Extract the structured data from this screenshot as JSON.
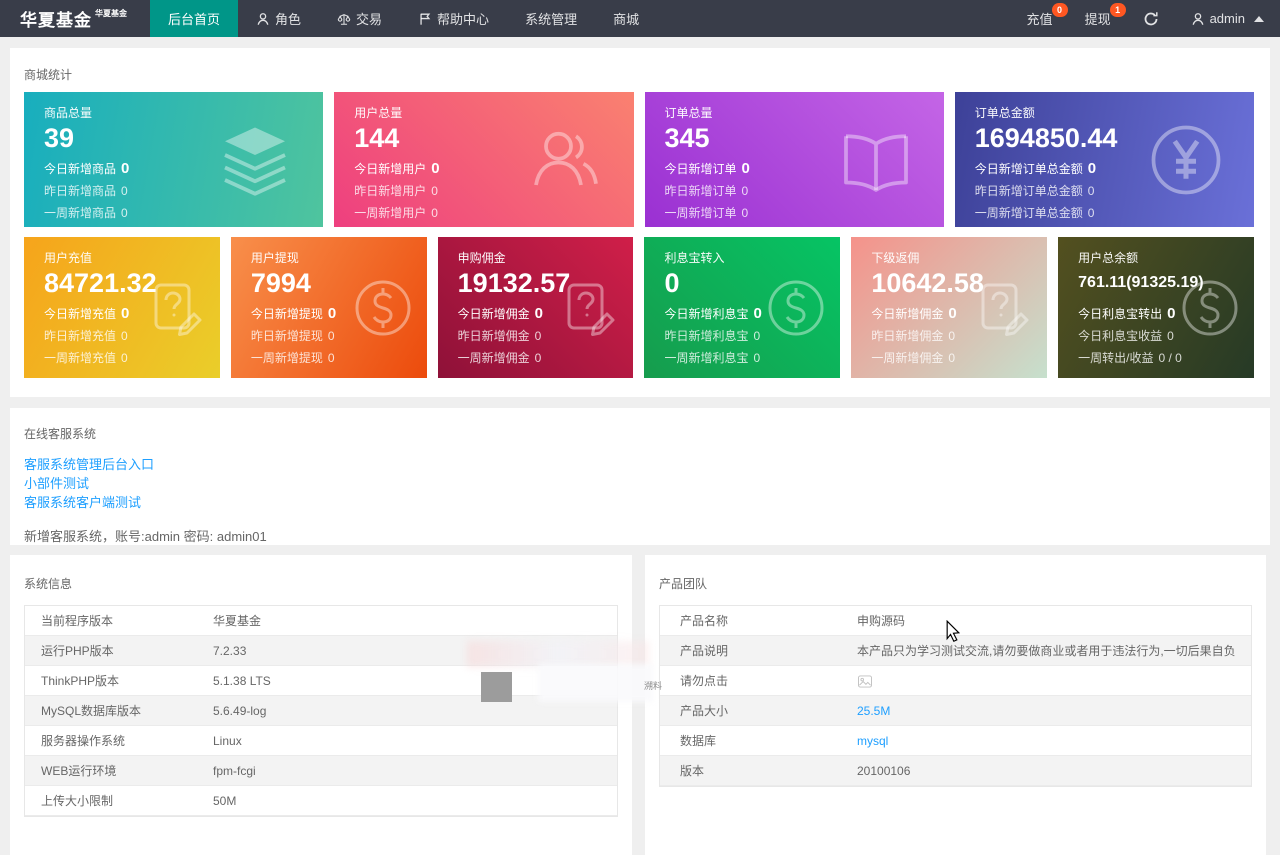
{
  "navbar": {
    "logo": "华夏基金",
    "logo_sup": "华夏基金",
    "items": [
      {
        "label": "后台首页",
        "icon": null,
        "active": true
      },
      {
        "label": "角色",
        "icon": "person",
        "active": false
      },
      {
        "label": "交易",
        "icon": "scales",
        "active": false
      },
      {
        "label": "帮助中心",
        "icon": "flag",
        "active": false
      },
      {
        "label": "系统管理",
        "icon": null,
        "active": false
      },
      {
        "label": "商城",
        "icon": null,
        "active": false
      }
    ],
    "right": [
      {
        "name": "recharge",
        "label": "充值",
        "badge": "0"
      },
      {
        "name": "withdraw",
        "label": "提现",
        "badge": "1"
      },
      {
        "name": "refresh",
        "label": "",
        "icon": "refresh"
      },
      {
        "name": "admin-menu",
        "label": "admin",
        "icon": "person",
        "caret": true
      }
    ],
    "colors": {
      "bg": "#393d49",
      "active": "#009688",
      "badge": "#ff5722"
    }
  },
  "stats": {
    "title": "商城统计",
    "row1": [
      {
        "title": "商品总量",
        "value": "39",
        "icon": "layers",
        "gradient": {
          "from": "#18aebe",
          "to": "#4fc49e",
          "dir": "100deg"
        },
        "stats": [
          {
            "label": "今日新增商品",
            "value": "0"
          },
          {
            "label": "昨日新增商品",
            "value": "0"
          },
          {
            "label": "一周新增商品",
            "value": "0"
          }
        ]
      },
      {
        "title": "用户总量",
        "value": "144",
        "icon": "users",
        "gradient": {
          "from": "#ee3f7f",
          "to": "#fa8170",
          "dir": "45deg"
        },
        "stats": [
          {
            "label": "今日新增用户",
            "value": "0"
          },
          {
            "label": "昨日新增用户",
            "value": "0"
          },
          {
            "label": "一周新增用户",
            "value": "0"
          }
        ]
      },
      {
        "title": "订单总量",
        "value": "345",
        "icon": "book",
        "gradient": {
          "from": "#9a30d2",
          "to": "#c465e6",
          "dir": "45deg"
        },
        "stats": [
          {
            "label": "今日新增订单",
            "value": "0"
          },
          {
            "label": "昨日新增订单",
            "value": "0"
          },
          {
            "label": "一周新增订单",
            "value": "0"
          }
        ]
      },
      {
        "title": "订单总金额",
        "value": "1694850.44",
        "icon": "yen",
        "gradient": {
          "from": "#3d4198",
          "to": "#6a70d8",
          "dir": "100deg"
        },
        "stats": [
          {
            "label": "今日新增订单总金额",
            "value": "0"
          },
          {
            "label": "昨日新增订单总金额",
            "value": "0"
          },
          {
            "label": "一周新增订单总金额",
            "value": "0"
          }
        ]
      }
    ],
    "row2": [
      {
        "title": "用户充值",
        "value": "84721.32",
        "icon": "doc",
        "gradient": {
          "from": "#f6a41b",
          "to": "#eace2a",
          "dir": "120deg"
        },
        "stats": [
          {
            "label": "今日新增充值",
            "value": "0"
          },
          {
            "label": "昨日新增充值",
            "value": "0"
          },
          {
            "label": "一周新增充值",
            "value": "0"
          }
        ]
      },
      {
        "title": "用户提现",
        "value": "7994",
        "icon": "dollar",
        "gradient": {
          "from": "#f88f4b",
          "to": "#ec4b0c",
          "dir": "120deg"
        },
        "stats": [
          {
            "label": "今日新增提现",
            "value": "0"
          },
          {
            "label": "昨日新增提现",
            "value": "0"
          },
          {
            "label": "一周新增提现",
            "value": "0"
          }
        ]
      },
      {
        "title": "申购佣金",
        "value": "19132.57",
        "icon": "doc",
        "gradient": {
          "from": "#8e1138",
          "to": "#d01f49",
          "dir": "45deg"
        },
        "stats": [
          {
            "label": "今日新增佣金",
            "value": "0"
          },
          {
            "label": "昨日新增佣金",
            "value": "0"
          },
          {
            "label": "一周新增佣金",
            "value": "0"
          }
        ]
      },
      {
        "title": "利息宝转入",
        "value": "0",
        "icon": "dollar",
        "gradient": {
          "from": "#169c4d",
          "to": "#06c464",
          "dir": "45deg"
        },
        "stats": [
          {
            "label": "今日新增利息宝",
            "value": "0"
          },
          {
            "label": "昨日新增利息宝",
            "value": "0"
          },
          {
            "label": "一周新增利息宝",
            "value": "0"
          }
        ]
      },
      {
        "title": "下级返佣",
        "value": "10642.58",
        "icon": "doc",
        "gradient": {
          "from": "#f5928a",
          "to": "#c6e0cd",
          "dir": "135deg"
        },
        "stats": [
          {
            "label": "今日新增佣金",
            "value": "0"
          },
          {
            "label": "昨日新增佣金",
            "value": "0"
          },
          {
            "label": "一周新增佣金",
            "value": "0"
          }
        ]
      },
      {
        "title": "用户总余额",
        "value": "761.11(91325.19)",
        "icon": "dollar",
        "gradient": {
          "from": "#53501f",
          "to": "#263a26",
          "dir": "120deg"
        },
        "stats": [
          {
            "label": "今日利息宝转出",
            "value": "0"
          },
          {
            "label": "今日利息宝收益",
            "value": "0"
          },
          {
            "label": "一周转出/收益",
            "value": "0 / 0"
          }
        ]
      }
    ]
  },
  "service": {
    "title": "在线客服系统",
    "links": [
      "客服系统管理后台入口",
      "小部件测试",
      "客服系统客户端测试"
    ],
    "note": "新增客服系统，账号:admin 密码: admin01"
  },
  "system_info": {
    "title": "系统信息",
    "rows": [
      {
        "label": "当前程序版本",
        "value": "华夏基金"
      },
      {
        "label": "运行PHP版本",
        "value": "7.2.33"
      },
      {
        "label": "ThinkPHP版本",
        "value": "5.1.38 LTS"
      },
      {
        "label": "MySQL数据库版本",
        "value": "5.6.49-log"
      },
      {
        "label": "服务器操作系统",
        "value": "Linux"
      },
      {
        "label": "WEB运行环境",
        "value": "fpm-fcgi"
      },
      {
        "label": "上传大小限制",
        "value": "50M"
      }
    ]
  },
  "product_team": {
    "title": "产品团队",
    "rows": [
      {
        "label": "产品名称",
        "value": "申购源码"
      },
      {
        "label": "产品说明",
        "value": "本产品只为学习测试交流,请勿要做商业或者用于违法行为,一切后果自负"
      },
      {
        "label": "请勿点击",
        "value": "",
        "image": true
      },
      {
        "label": "产品大小",
        "value": "25.5M",
        "link": true
      },
      {
        "label": "数据库",
        "value": "mysql",
        "link": true
      },
      {
        "label": "版本",
        "value": "20100106"
      }
    ]
  },
  "watermark": {
    "text": "溯料"
  }
}
